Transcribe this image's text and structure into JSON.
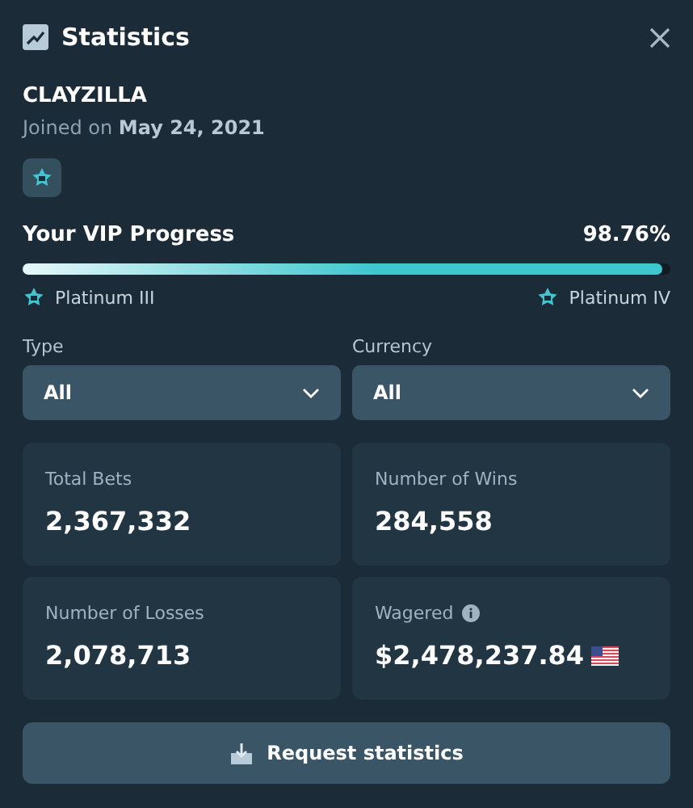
{
  "header": {
    "title": "Statistics"
  },
  "user": {
    "name": "CLAYZILLA",
    "joined": "Joined on **May 24, 2021**"
  },
  "vip": {
    "label": "Your VIP Progress",
    "percent": "98.76%",
    "level": 0.9876,
    "current_tier": "Platinum III",
    "next_tier": "Platinum IV"
  },
  "filters": [
    {
      "label": "Type",
      "value": "All"
    },
    {
      "label": "Currency",
      "value": "All"
    }
  ],
  "stats": [
    {
      "kind": "count",
      "label": "Total Bets",
      "value": "2,367,332",
      "info": false
    },
    {
      "kind": "count",
      "label": "Number of Wins",
      "value": "284,558",
      "info": false
    },
    {
      "kind": "count",
      "label": "Number of Losses",
      "value": "2,078,713",
      "info": false
    },
    {
      "kind": "money",
      "label": "Wagered",
      "value": "$2,478,237.84",
      "info": true
    }
  ],
  "button": {
    "label": "Request statistics"
  }
}
